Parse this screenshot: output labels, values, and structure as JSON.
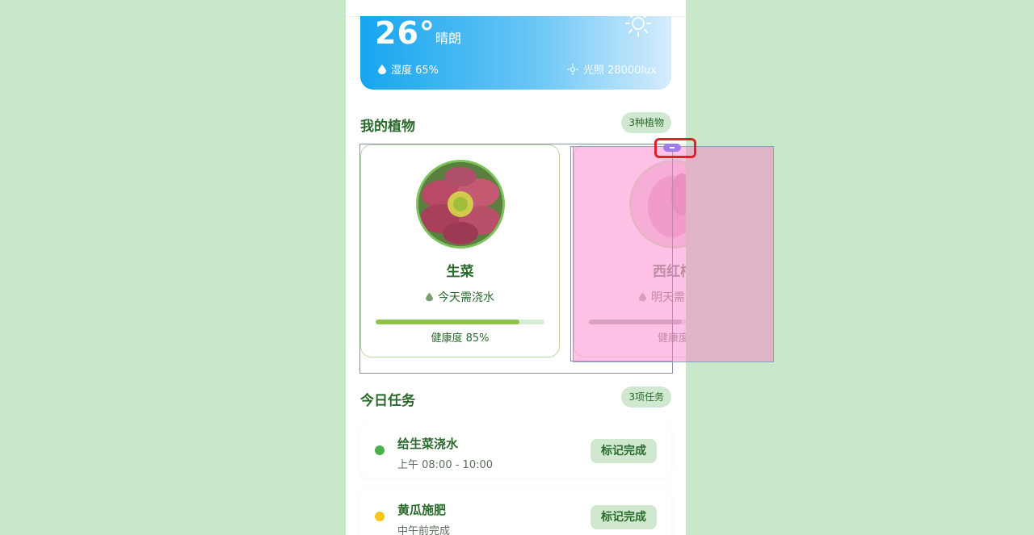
{
  "weather": {
    "temperature": "26°",
    "condition": "晴朗",
    "humidity": "湿度 65%",
    "light": "光照 28000lux"
  },
  "plants_section": {
    "title": "我的植物",
    "badge": "3种植物"
  },
  "plants": [
    {
      "name": "生菜",
      "water": "今天需浇水",
      "health": "健康度 85%",
      "health_fraction": 0.85
    },
    {
      "name": "西红柿",
      "water": "明天需浇水",
      "health": "健康度",
      "health_fraction": 0.55
    }
  ],
  "tasks_section": {
    "title": "今日任务",
    "badge": "3项任务"
  },
  "tasks": [
    {
      "title": "给生菜浇水",
      "time": "上午 08:00 - 10:00",
      "action": "标记完成",
      "dot_color": "#4caf50"
    },
    {
      "title": "黄瓜施肥",
      "time": "中午前完成",
      "action": "标记完成",
      "dot_color": "#f5c518"
    }
  ],
  "colors": {
    "accent": "#2a6a2c",
    "badge_bg": "#cfe8cf",
    "health_bar": "#8bc34a"
  },
  "icons": {
    "drop": "water-drop-icon",
    "sun": "sun-icon",
    "light": "sun-small-icon"
  }
}
